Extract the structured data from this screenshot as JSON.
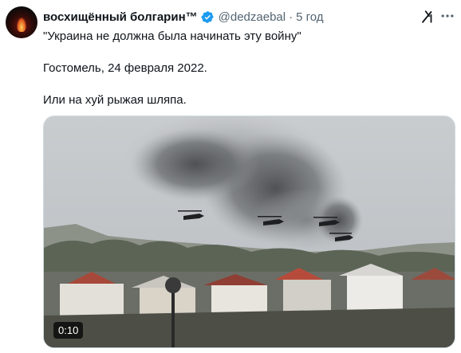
{
  "tweet": {
    "author_name": "восхищённый болгарин™",
    "handle": "@dedzaebal",
    "separator": "·",
    "time": "5 год",
    "lines": [
      "\"Украина не должна была начинать эту войну\"",
      "Гостомель, 24 февраля 2022.",
      "Или на хуй рыжая шляпа."
    ]
  },
  "media": {
    "duration": "0:10"
  },
  "colors": {
    "verified": "#1d9bf0",
    "secondary_text": "#536471"
  },
  "icons": [
    "verified-badge-icon",
    "grok-icon",
    "more-icon"
  ]
}
